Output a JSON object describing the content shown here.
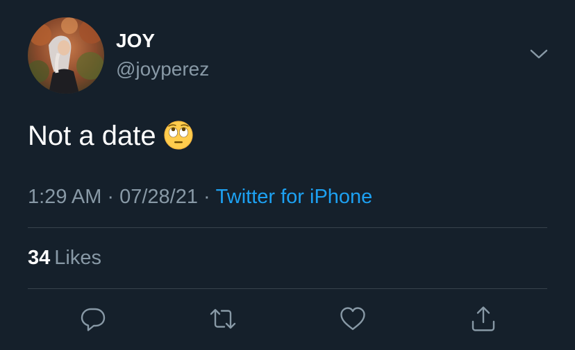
{
  "author": {
    "display_name": "JOY",
    "handle": "@joyperez",
    "avatar": "profile-photo"
  },
  "tweet": {
    "text": "Not a date",
    "emoji": "face-with-rolling-eyes"
  },
  "meta": {
    "time": "1:29 AM",
    "separator": "·",
    "date": "07/28/21",
    "source": "Twitter for iPhone"
  },
  "stats": {
    "likes_count": "34",
    "likes_label": "Likes"
  },
  "actions": [
    {
      "name": "reply",
      "icon": "speech-bubble-icon"
    },
    {
      "name": "retweet",
      "icon": "retweet-arrows-icon"
    },
    {
      "name": "like",
      "icon": "heart-icon"
    },
    {
      "name": "share",
      "icon": "share-upload-icon"
    }
  ],
  "colors": {
    "background": "#15202b",
    "primary_text": "#ffffff",
    "secondary_text": "#8899a6",
    "link": "#1da1f2",
    "divider": "#38444d"
  }
}
